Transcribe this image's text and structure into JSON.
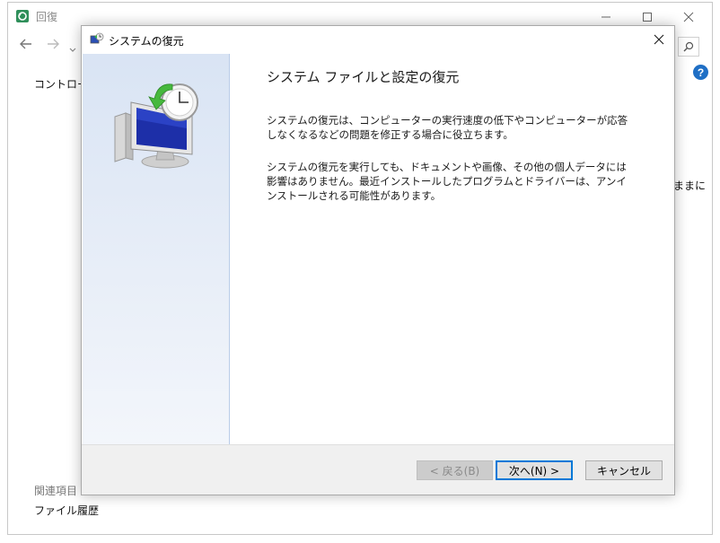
{
  "background_window": {
    "title": "回復",
    "control_panel_label": "コントロール",
    "right_clip_text": "ままに",
    "related_items_label": "関連項目",
    "file_history_link": "ファイル履歴",
    "help_glyph": "?"
  },
  "dialog": {
    "title": "システムの復元",
    "heading": "システム ファイルと設定の復元",
    "paragraph1": "システムの復元は、コンピューターの実行速度の低下やコンピューターが応答しなくなるなどの問題を修正する場合に役立ちます。",
    "paragraph2": "システムの復元を実行しても、ドキュメントや画像、その他の個人データには影響はありません。最近インストールしたプログラムとドライバーは、アンインストールされる可能性があります。",
    "buttons": {
      "back": "< 戻る(B)",
      "next": "次へ(N) >",
      "cancel": "キャンセル"
    }
  },
  "colors": {
    "accent": "#0078d7",
    "side_panel_top": "#d9e4f4",
    "help_blue": "#1f6fc5"
  },
  "icons": [
    "restore-app-icon",
    "back-arrow-icon",
    "forward-arrow-icon",
    "chevron-down-icon",
    "search-icon",
    "help-icon",
    "minimize-icon",
    "maximize-icon",
    "close-icon",
    "system-restore-illustration"
  ]
}
